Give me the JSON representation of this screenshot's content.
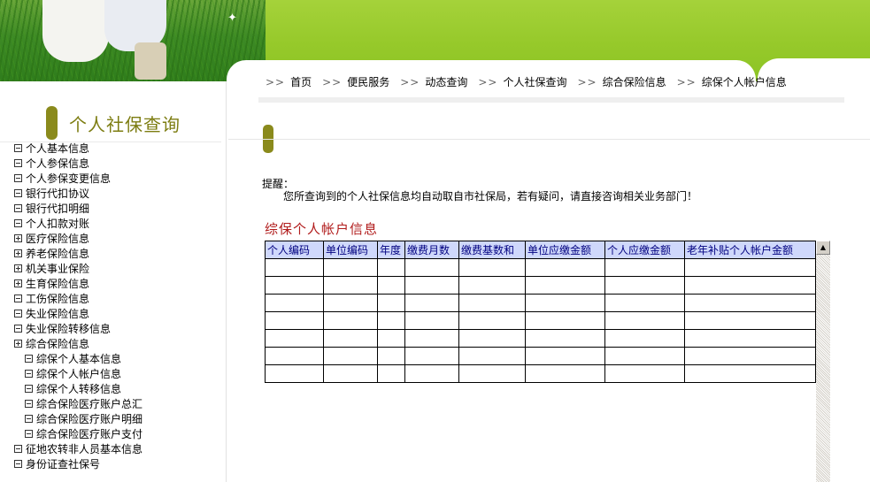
{
  "breadcrumb": {
    "separator": ">>",
    "items": [
      "首页",
      "便民服务",
      "动态查询",
      "个人社保查询",
      "综合保险信息",
      "综保个人帐户信息"
    ]
  },
  "sidebar": {
    "title": "个人社保查询",
    "items": [
      {
        "label": "个人基本信息",
        "icon": "minus-box-icon"
      },
      {
        "label": "个人参保信息",
        "icon": "minus-box-icon"
      },
      {
        "label": "个人参保变更信息",
        "icon": "minus-box-icon"
      },
      {
        "label": "银行代扣协议",
        "icon": "minus-box-icon"
      },
      {
        "label": "银行代扣明细",
        "icon": "minus-box-icon"
      },
      {
        "label": "个人扣款对账",
        "icon": "minus-box-icon"
      },
      {
        "label": "医疗保险信息",
        "icon": "plus-box-icon"
      },
      {
        "label": "养老保险信息",
        "icon": "plus-box-icon"
      },
      {
        "label": "机关事业保险",
        "icon": "plus-box-icon"
      },
      {
        "label": "生育保险信息",
        "icon": "plus-box-icon"
      },
      {
        "label": "工伤保险信息",
        "icon": "minus-box-icon"
      },
      {
        "label": "失业保险信息",
        "icon": "minus-box-icon"
      },
      {
        "label": "失业保险转移信息",
        "icon": "minus-box-icon"
      },
      {
        "label": "综合保险信息",
        "icon": "plus-box-icon"
      },
      {
        "label": "综保个人基本信息",
        "icon": "minus-box-icon",
        "child": true
      },
      {
        "label": "综保个人帐户信息",
        "icon": "minus-box-icon",
        "child": true
      },
      {
        "label": "综保个人转移信息",
        "icon": "minus-box-icon",
        "child": true
      },
      {
        "label": "综合保险医疗账户总汇",
        "icon": "minus-box-icon",
        "child": true
      },
      {
        "label": "综合保险医疗账户明细",
        "icon": "minus-box-icon",
        "child": true
      },
      {
        "label": "综合保险医疗账户支付",
        "icon": "minus-box-icon",
        "child": true
      },
      {
        "label": "征地农转非人员基本信息",
        "icon": "minus-box-icon"
      },
      {
        "label": "身份证查社保号",
        "icon": "minus-box-icon"
      }
    ]
  },
  "notice": {
    "label": "提醒：",
    "text": "您所查询到的个人社保信息均自动取自市社保局，若有疑问，请直接咨询相关业务部门！"
  },
  "section": {
    "title": "综保个人帐户信息"
  },
  "table": {
    "headers": [
      "个人编码",
      "单位编码",
      "年度",
      "缴费月数",
      "缴费基数和",
      "单位应缴金额",
      "个人应缴金额",
      "老年补贴个人帐户金额"
    ],
    "empty_rows": 7
  },
  "colors": {
    "banner_green": "#96c92a",
    "marker_olive": "#8a8a1c",
    "section_title_red": "#b11c1c",
    "table_header_bg": "#cfd8fb"
  }
}
